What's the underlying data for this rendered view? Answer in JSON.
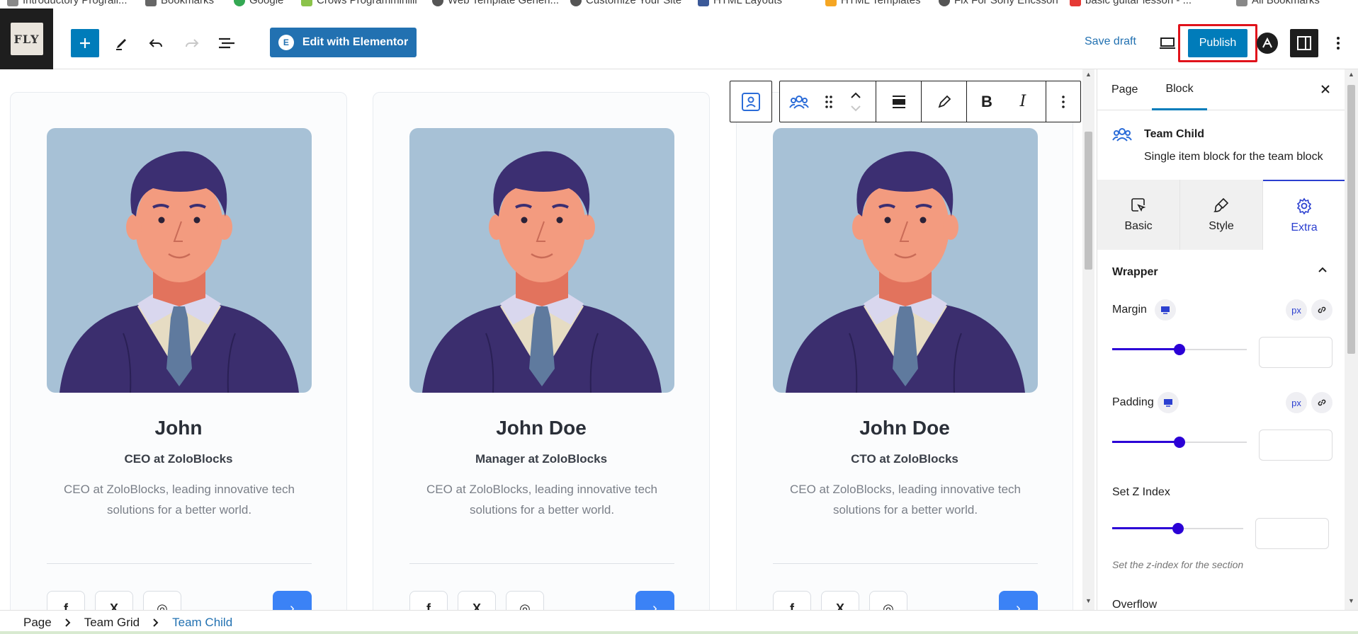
{
  "bookmarks": [
    {
      "label": "Introductory Prograll...",
      "icon": "document-icon"
    },
    {
      "label": "Bookmarks",
      "icon": "star-icon"
    },
    {
      "label": "Google",
      "icon": "google-icon"
    },
    {
      "label": "Crows Programminiiii",
      "icon": "folder-icon"
    },
    {
      "label": "Web Template Generi...",
      "icon": "globe-icon"
    },
    {
      "label": "Customize Your Site",
      "icon": "globe-icon"
    },
    {
      "label": "HTML Layouts",
      "icon": "grid-icon"
    },
    {
      "label": "HTML Templates",
      "icon": "grid-icon"
    },
    {
      "label": "Fix For Sony Ericsson",
      "icon": "globe-icon"
    },
    {
      "label": "basic guitar lesson - ...",
      "icon": "video-icon"
    },
    {
      "label": "All Bookmarks",
      "icon": "folder-icon"
    }
  ],
  "toolbar": {
    "logo_text": "FLY",
    "elementor_badge": "E",
    "elementor_label": "Edit with Elementor",
    "save_draft_label": "Save draft",
    "publish_label": "Publish"
  },
  "cards": [
    {
      "name": "John",
      "role": "CEO at ZoloBlocks",
      "description": "CEO at ZoloBlocks, leading innovative tech solutions for a better world."
    },
    {
      "name": "John Doe",
      "role": "Manager at ZoloBlocks",
      "description": "CEO at ZoloBlocks, leading innovative tech solutions for a better world."
    },
    {
      "name": "John Doe",
      "role": "CTO at ZoloBlocks",
      "description": "CEO at ZoloBlocks, leading innovative tech solutions for a better world."
    }
  ],
  "social": {
    "facebook": "f",
    "x": "X",
    "instagram": "◎",
    "arrow": "›"
  },
  "panel": {
    "tabs": {
      "page": "Page",
      "block": "Block"
    },
    "block_title": "Team Child",
    "block_description": "Single item block for the team block",
    "mode_tabs": {
      "basic": "Basic",
      "style": "Style",
      "extra": "Extra"
    },
    "section_title": "Wrapper",
    "margin": {
      "label": "Margin",
      "unit": "px",
      "slider_fraction": 0.5
    },
    "padding": {
      "label": "Padding",
      "unit": "px",
      "slider_fraction": 0.5
    },
    "zindex": {
      "label": "Set Z Index",
      "slider_fraction": 0.5,
      "help": "Set the z-index for the section"
    },
    "overflow_label": "Overflow"
  },
  "breadcrumb": [
    "Page",
    "Team Grid",
    "Team Child"
  ],
  "colors": {
    "accent": "#007cba",
    "publish_outline": "#e0121b",
    "slider": "#2b00d6",
    "photo_bg": "#a7c1d6",
    "arrow_button": "#3b82f6"
  }
}
